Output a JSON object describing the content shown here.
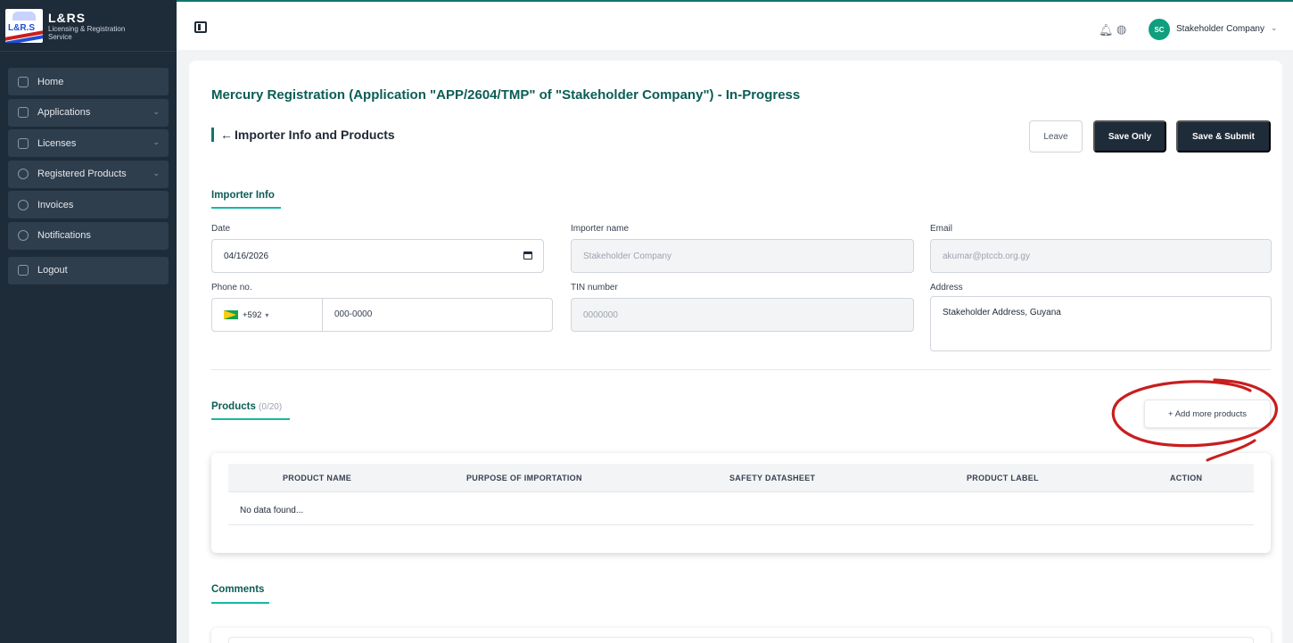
{
  "brand": {
    "name": "L&RS",
    "subtitle_line1": "Licensing & Registration",
    "subtitle_line2": "Service",
    "logo_text": "L&R.S"
  },
  "sidebar": {
    "items": [
      {
        "label": "Home",
        "icon": "home-icon"
      },
      {
        "label": "Applications",
        "icon": "document-icon"
      },
      {
        "label": "Licenses",
        "icon": "license-icon"
      },
      {
        "label": "Registered Products",
        "icon": "box-icon"
      },
      {
        "label": "Invoices",
        "icon": "invoice-icon"
      },
      {
        "label": "Notifications",
        "icon": "bell-icon"
      },
      {
        "label": "Logout",
        "icon": "logout-icon"
      }
    ]
  },
  "topbar": {
    "avatar_initials": "SC",
    "company": "Stakeholder Company"
  },
  "page": {
    "title": "Mercury Registration  (Application \"APP/2604/TMP\" of \"Stakeholder Company\") - In-Progress",
    "section_back": "←",
    "section_title": "Importer Info and Products",
    "buttons": {
      "leave": "Leave",
      "save_only": "Save Only",
      "save_submit": "Save & Submit"
    }
  },
  "importer": {
    "tab": "Importer Info",
    "date_label": "Date",
    "date_value": "04/16/2026",
    "name_label": "Importer name",
    "name_value": "Stakeholder Company",
    "email_label": "Email",
    "email_value": "akumar@ptccb.org.gy",
    "phone_label": "Phone no.",
    "phone_code": "+592",
    "phone_placeholder": "000-0000",
    "tin_label": "TIN number",
    "tin_placeholder": "0000000",
    "address_label": "Address",
    "address_value": "Stakeholder Address, Guyana"
  },
  "products": {
    "tab": "Products",
    "count": "(0/20)",
    "add_button": "+ Add more products",
    "columns": [
      "PRODUCT NAME",
      "PURPOSE OF IMPORTATION",
      "SAFETY DATASHEET",
      "PRODUCT LABEL",
      "ACTION"
    ],
    "empty": "No data found..."
  },
  "comments": {
    "tab": "Comments"
  },
  "colors": {
    "accent": "#0f766e",
    "sidebar": "#1e2b38",
    "annotation": "#c81e1e"
  }
}
